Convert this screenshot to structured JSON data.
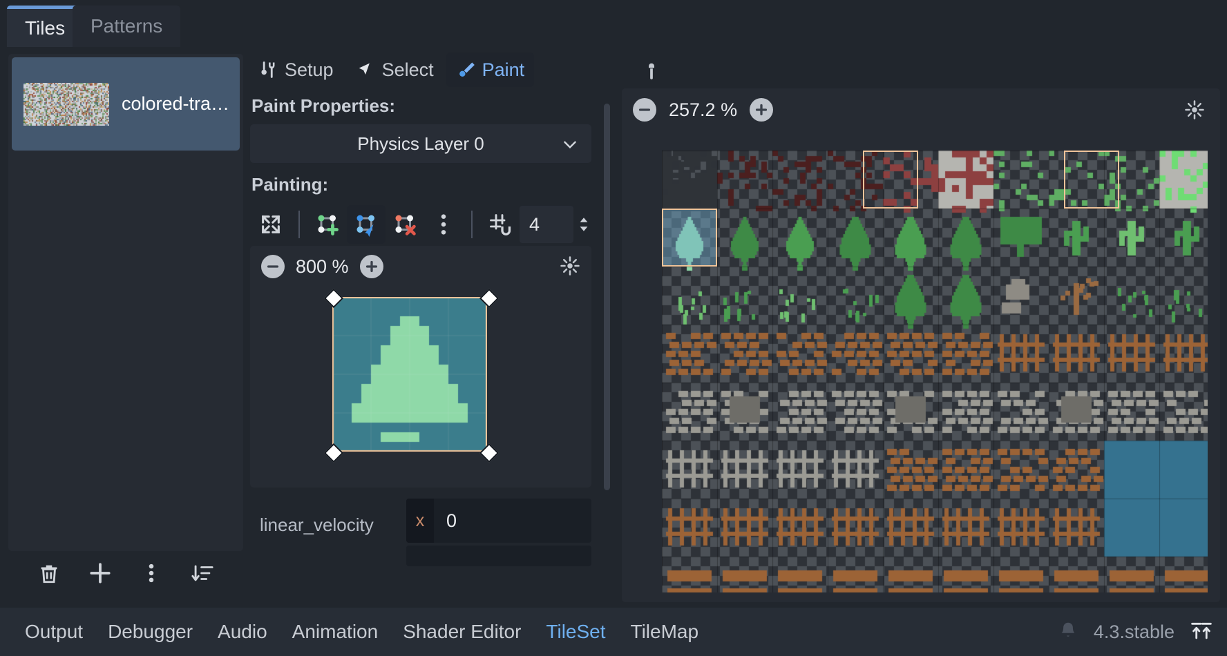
{
  "tabs": {
    "items": [
      {
        "label": "Tiles",
        "active": true
      },
      {
        "label": "Patterns",
        "active": false
      }
    ]
  },
  "source_list": {
    "items": [
      {
        "label": "colored-tra…",
        "selected": true
      }
    ],
    "toolbar": [
      {
        "name": "delete-source-button",
        "icon": "trash-icon"
      },
      {
        "name": "add-source-button",
        "icon": "plus-icon"
      },
      {
        "name": "source-menu-button",
        "icon": "vertical-dots-icon"
      },
      {
        "name": "sort-sources-button",
        "icon": "sort-icon"
      }
    ]
  },
  "editor_modes": [
    {
      "label": "Setup",
      "icon": "tools-icon",
      "active": false
    },
    {
      "label": "Select",
      "icon": "cursor-arrow-icon",
      "active": false
    },
    {
      "label": "Paint",
      "icon": "paintbrush-icon",
      "active": true
    }
  ],
  "pick_tool": {
    "name": "eyedropper-icon"
  },
  "paint_properties": {
    "title": "Paint Properties:",
    "layer_select": {
      "value": "Physics Layer 0"
    }
  },
  "painting": {
    "title": "Painting:",
    "tools": [
      {
        "name": "expand-polygon-button",
        "icon": "expand-arrows-icon",
        "active": false
      },
      {
        "name": "create-polygon-button",
        "icon": "polygon-add-icon",
        "active": false
      },
      {
        "name": "edit-points-button",
        "icon": "polygon-edit-icon",
        "active": true
      },
      {
        "name": "delete-polygon-button",
        "icon": "polygon-delete-icon",
        "active": false
      },
      {
        "name": "polygon-menu-button",
        "icon": "vertical-dots-icon",
        "active": false
      },
      {
        "name": "grid-snap-toggle",
        "icon": "grid-snap-icon",
        "active": false
      }
    ],
    "snap_value": "4"
  },
  "tile_preview": {
    "zoom": "800 %",
    "zoom_out_label": "−",
    "zoom_in_label": "+",
    "center_view_name": "center-view-icon"
  },
  "tile_property": {
    "label": "linear_velocity",
    "axis": "x",
    "value": "0"
  },
  "atlas": {
    "zoom": "257.2 %",
    "zoom_out_label": "−",
    "zoom_in_label": "+",
    "center_view_name": "center-view-icon",
    "selections": [
      {
        "name": "selected-tile-tree",
        "col": 0,
        "row": 1,
        "w": 1,
        "h": 1,
        "style": "blue"
      },
      {
        "name": "highlighted-tile-red-bricks",
        "col": 5,
        "row": 0,
        "w": 1,
        "h": 1,
        "style": "outline"
      },
      {
        "name": "highlighted-tile-green-grass",
        "col": 9,
        "row": 0,
        "w": 1,
        "h": 1,
        "style": "outline"
      }
    ]
  },
  "status_bar": {
    "tabs": [
      {
        "label": "Output",
        "active": false
      },
      {
        "label": "Debugger",
        "active": false
      },
      {
        "label": "Audio",
        "active": false
      },
      {
        "label": "Animation",
        "active": false
      },
      {
        "label": "Shader Editor",
        "active": false
      },
      {
        "label": "TileSet",
        "active": true
      },
      {
        "label": "TileMap",
        "active": false
      }
    ],
    "notification_icon": "bell-icon",
    "version": "4.3.stable",
    "expand_icon": "expand-bottom-panel-icon"
  },
  "colors": {
    "accent": "#6fb0f0",
    "panel": "#262b33",
    "background": "#21262d",
    "selection": "#44586f",
    "handle_outline": "#f0c49a"
  }
}
